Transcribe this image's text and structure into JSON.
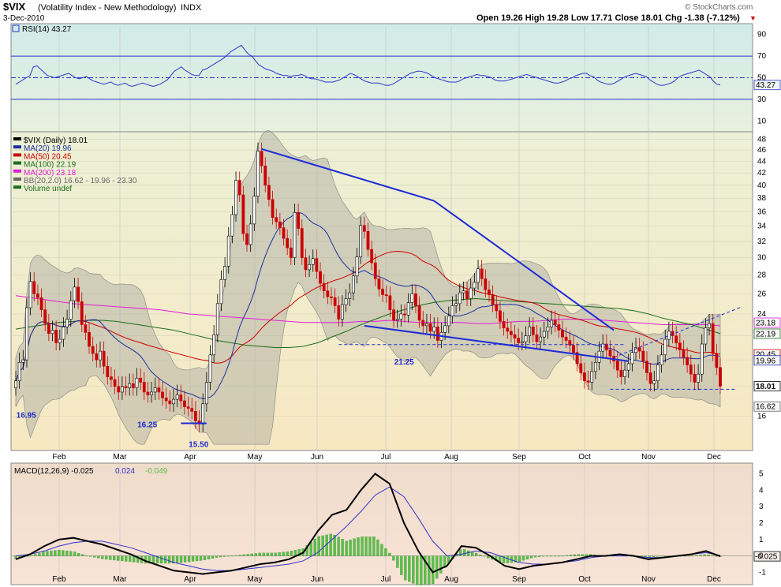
{
  "header": {
    "symbol": "$VIX",
    "description": "(Volatility Index - New Methodology)",
    "exchange": "INDX",
    "date": "3-Dec-2010",
    "quote": "Open 19.26  High 19.28  Low 17.71  Close 18.01  Chg -1.38 (-7.12%)",
    "watermark": "© StockCharts.com",
    "down_marker": "▼"
  },
  "colors": {
    "up_candle": "#000000",
    "down_candle": "#cc0000",
    "ma20": "#1a2fa0",
    "ma50": "#cc0000",
    "ma100": "#1b6e1b",
    "ma200": "#e01fd8",
    "bollinger_fill": "#a9a9a0",
    "trendlines": "#1d2bd6",
    "rsi_line": "#2b36c8",
    "macd_line": "#000000",
    "signal_line": "#3333cc",
    "histogram": "#5bbf4a",
    "rsi_bg": "#d3ece9",
    "price_bg": "#f6eec8",
    "macd_bg": "#f3dccf"
  },
  "chart_data": [
    {
      "panel": "RSI",
      "type": "line",
      "legend": "RSI(14) 43.27",
      "y_ticks": [
        10,
        30,
        50,
        70,
        90
      ],
      "ylim": [
        0,
        100
      ],
      "reference_lines": [
        30,
        50,
        70
      ],
      "last_value_label": "43.27",
      "x_tick_labels": [
        "Feb",
        "Mar",
        "Apr",
        "May",
        "Jun",
        "Jul",
        "Aug",
        "Sep",
        "Oct",
        "Nov",
        "Dec"
      ],
      "series": [
        {
          "name": "RSI(14)",
          "values": [
            44,
            46,
            48,
            50,
            52,
            60,
            61,
            58,
            55,
            52,
            51,
            50,
            51,
            52,
            53,
            54,
            52,
            50,
            49,
            50,
            51,
            49,
            47,
            46,
            45,
            44,
            45,
            46,
            44,
            43,
            44,
            45,
            43,
            42,
            43,
            44,
            45,
            44,
            43,
            42,
            43,
            44,
            46,
            48,
            52,
            56,
            58,
            60,
            57,
            55,
            53,
            52,
            52,
            57,
            58,
            60,
            62,
            64,
            66,
            68,
            71,
            74,
            76,
            78,
            80,
            76,
            72,
            70,
            66,
            62,
            60,
            58,
            57,
            56,
            54,
            53,
            52,
            52,
            51,
            52,
            52,
            53,
            52,
            50,
            49,
            49,
            48,
            47,
            46,
            46,
            46,
            47,
            48,
            50,
            52,
            54,
            53,
            51,
            49,
            47,
            46,
            45,
            45,
            45,
            44,
            43,
            43,
            44,
            46,
            48,
            50,
            52,
            54,
            55,
            56,
            56,
            55,
            54,
            52,
            50,
            49,
            48,
            47,
            46,
            46,
            46,
            47,
            49,
            50,
            51,
            52,
            53,
            52,
            52,
            51,
            50,
            48,
            47,
            47,
            47,
            48,
            49,
            50,
            51,
            52,
            53,
            52,
            51,
            50,
            49,
            48,
            47,
            46,
            45,
            45,
            46,
            47,
            49,
            50,
            52,
            53,
            54,
            54,
            52,
            51,
            48,
            46,
            45,
            44,
            44,
            45,
            47,
            49,
            51,
            52,
            53,
            54,
            53,
            52,
            51,
            48,
            46,
            44,
            43,
            43,
            44,
            45,
            47,
            50,
            52,
            53,
            54,
            55,
            56,
            57,
            55,
            53,
            51,
            47,
            44,
            43.27
          ]
        }
      ]
    },
    {
      "panel": "Price",
      "type": "candlestick",
      "legend": [
        {
          "text": "$VIX (Daily) 18.01",
          "color": "#000000"
        },
        {
          "text": "MA(20) 19.96",
          "color": "#1a2fa0"
        },
        {
          "text": "MA(50) 20.45",
          "color": "#cc0000"
        },
        {
          "text": "MA(100) 22.19",
          "color": "#1b6e1b"
        },
        {
          "text": "MA(200) 23.18",
          "color": "#e01fd8"
        },
        {
          "text": "BB(20,2.0) 16.62 - 19.96 - 23.30",
          "color": "#666666"
        },
        {
          "text": "Volume undef",
          "color": "#1b6e1b"
        }
      ],
      "y_ticks": [
        16,
        18,
        20,
        22,
        24,
        26,
        28,
        30,
        32,
        34,
        36,
        38,
        40,
        42,
        44,
        46,
        48
      ],
      "ylim": [
        14,
        49
      ],
      "x_tick_labels": [
        "Feb",
        "Mar",
        "Apr",
        "May",
        "Jun",
        "Jul",
        "Aug",
        "Sep",
        "Oct",
        "Nov",
        "Dec"
      ],
      "annotations": [
        "16.95",
        "16.25",
        "15.50",
        "21.25"
      ],
      "right_axis_labels": [
        {
          "text": "23.18",
          "value": 23.18,
          "color": "#e01fd8"
        },
        {
          "text": "22.19",
          "value": 22.19,
          "color": "#1b6e1b"
        },
        {
          "text": "20.45",
          "value": 20.45,
          "color": "#cc0000"
        },
        {
          "text": "19.96",
          "value": 19.96,
          "color": "#1a2fa0"
        },
        {
          "text": "18.01",
          "value": 18.01,
          "color": "#000000"
        },
        {
          "text": "16.62",
          "value": 16.62,
          "color": "#666666"
        }
      ],
      "close_series": [
        18.4,
        19.8,
        20.0,
        24.6,
        27.3,
        26.0,
        25.6,
        24.4,
        23.1,
        22.2,
        22.5,
        21.4,
        21.7,
        22.8,
        23.5,
        25.3,
        26.7,
        25.2,
        23.0,
        22.3,
        21.1,
        20.5,
        20.0,
        20.7,
        19.5,
        18.7,
        18.5,
        18.0,
        17.6,
        18.0,
        17.9,
        18.2,
        17.9,
        18.6,
        18.3,
        17.6,
        17.4,
        17.6,
        17.9,
        17.6,
        17.2,
        17.0,
        16.8,
        17.1,
        17.4,
        17.0,
        16.6,
        16.5,
        16.3,
        15.7,
        15.5,
        16.8,
        18.3,
        20.4,
        22.1,
        25.0,
        27.5,
        29.0,
        32.7,
        35.6,
        40.8,
        38.5,
        33.0,
        31.6,
        34.3,
        38.3,
        45.8,
        43.2,
        40.0,
        37.8,
        35.2,
        34.6,
        33.8,
        32.4,
        31.2,
        30.0,
        35.9,
        33.7,
        30.0,
        28.6,
        29.2,
        29.9,
        28.4,
        27.1,
        26.3,
        25.7,
        25.6,
        24.8,
        23.5,
        24.9,
        25.5,
        26.1,
        27.9,
        30.1,
        34.1,
        33.3,
        31.0,
        29.4,
        27.6,
        26.5,
        25.9,
        25.8,
        24.4,
        23.4,
        23.5,
        24.0,
        23.9,
        25.1,
        26.0,
        24.8,
        23.4,
        22.9,
        23.1,
        22.4,
        22.8,
        21.6,
        22.3,
        22.9,
        23.8,
        24.8,
        25.0,
        26.1,
        26.3,
        25.5,
        26.6,
        27.2,
        28.7,
        27.6,
        26.4,
        25.9,
        24.9,
        24.3,
        23.3,
        22.7,
        22.4,
        22.1,
        21.8,
        21.4,
        21.5,
        22.0,
        22.8,
        22.1,
        21.5,
        21.9,
        22.4,
        22.8,
        23.4,
        23.0,
        22.5,
        21.9,
        21.6,
        21.2,
        20.6,
        19.7,
        19.0,
        18.4,
        18.3,
        19.1,
        19.8,
        20.7,
        21.3,
        20.8,
        20.3,
        19.9,
        19.2,
        18.7,
        19.2,
        19.7,
        20.6,
        21.0,
        20.7,
        19.9,
        19.0,
        18.2,
        18.4,
        19.6,
        20.4,
        21.7,
        22.4,
        22.0,
        21.4,
        20.8,
        20.2,
        19.6,
        18.9,
        18.3,
        18.9,
        21.3,
        22.7,
        23.1,
        20.5,
        19.4,
        18.01
      ],
      "ma200_series": [
        25.8,
        25.6,
        25.4,
        25.2,
        25.0,
        24.9,
        24.8,
        24.7,
        24.6,
        24.5,
        24.4,
        24.2,
        24.0,
        23.9,
        23.8,
        23.7,
        23.6,
        23.5,
        23.4,
        23.3,
        23.2,
        23.2,
        23.2,
        23.2,
        23.3,
        23.3,
        23.4,
        23.3,
        23.2,
        23.2,
        23.2,
        23.2,
        23.1,
        23.1,
        23.2,
        23.3,
        23.3,
        23.4,
        23.5,
        23.5,
        23.5,
        23.4,
        23.3,
        23.2,
        23.1,
        23.0,
        23.0,
        23.0,
        23.0,
        22.9
      ],
      "ma100_series": [
        22.6,
        22.8,
        23.0,
        23.2,
        23.3,
        23.4,
        23.4,
        23.3,
        23.1,
        22.9,
        22.7,
        22.5,
        22.2,
        21.9,
        21.6,
        21.4,
        21.2,
        21.1,
        21.0,
        21.0,
        21.1,
        21.4,
        21.9,
        22.4,
        23.0,
        23.5,
        24.0,
        24.4,
        24.8,
        25.1,
        25.3,
        25.4,
        25.5,
        25.4,
        25.3,
        25.2,
        25.1,
        25.0,
        24.9,
        24.8,
        24.7,
        24.6,
        24.5,
        24.3,
        24.0,
        23.6,
        23.3,
        23.0,
        22.6,
        22.19
      ]
    },
    {
      "panel": "MACD",
      "type": "line",
      "legend": [
        {
          "text": "MACD(12,26,9) -0.025",
          "color": "#000000"
        },
        {
          "text": "0.024",
          "color": "#3333cc"
        },
        {
          "text": "-0.049",
          "color": "#5bbf4a"
        }
      ],
      "y_ticks": [
        -1,
        0,
        1,
        2,
        3,
        4,
        5
      ],
      "ylim": [
        -1.7,
        5.6
      ],
      "last_value_label": "-0.025",
      "x_tick_labels": [
        "Feb",
        "Mar",
        "Apr",
        "May",
        "Jun",
        "Jul",
        "Aug",
        "Sep",
        "Oct",
        "Nov",
        "Dec"
      ],
      "series": [
        {
          "name": "MACD(12,26,9)",
          "values": [
            -0.2,
            0.1,
            0.6,
            1.0,
            1.1,
            0.9,
            0.7,
            0.4,
            0.1,
            -0.3,
            -0.6,
            -0.9,
            -1.0,
            -1.1,
            -1.0,
            -0.9,
            -0.7,
            -0.5,
            -0.4,
            -0.2,
            0.2,
            1.5,
            2.5,
            2.8,
            4.0,
            5.0,
            4.4,
            2.0,
            0.3,
            -1.0,
            -0.6,
            0.6,
            0.5,
            0.0,
            -0.6,
            -0.8,
            -0.6,
            -0.5,
            -0.4,
            -0.2,
            0.0,
            0.0,
            0.1,
            0.0,
            -0.2,
            -0.1,
            0.0,
            0.1,
            0.3,
            -0.025
          ]
        },
        {
          "name": "0.024",
          "values": [
            0.0,
            0.1,
            0.3,
            0.6,
            0.8,
            0.9,
            0.9,
            0.7,
            0.5,
            0.2,
            -0.1,
            -0.4,
            -0.6,
            -0.8,
            -0.9,
            -0.9,
            -0.8,
            -0.7,
            -0.6,
            -0.5,
            -0.3,
            0.2,
            1.0,
            1.8,
            2.7,
            3.7,
            4.2,
            3.6,
            2.3,
            0.9,
            0.0,
            0.1,
            0.3,
            0.2,
            -0.1,
            -0.4,
            -0.5,
            -0.5,
            -0.4,
            -0.3,
            -0.1,
            0.0,
            0.0,
            0.0,
            -0.1,
            -0.1,
            0.0,
            0.1,
            0.2,
            0.024
          ]
        }
      ]
    }
  ]
}
